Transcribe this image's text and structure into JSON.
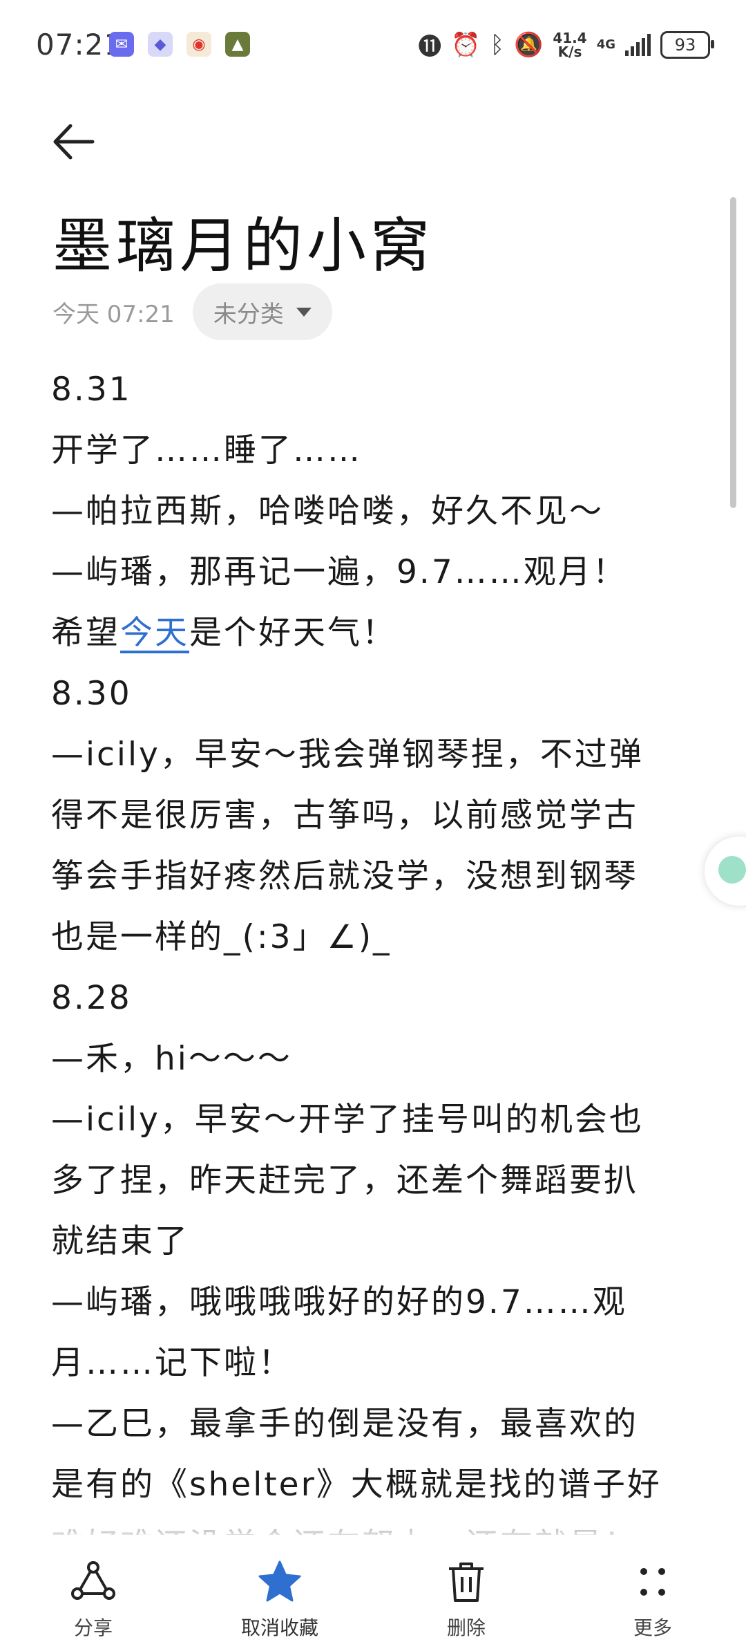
{
  "status_bar": {
    "time": "07:21",
    "network_speed": "41.4",
    "network_unit": "K/s",
    "network_type": "4G",
    "battery": "93",
    "app_icons": [
      "mail-app-icon",
      "shield-app-icon",
      "weibo-app-icon",
      "game-app-icon"
    ]
  },
  "note": {
    "title": "墨璃月的小窝",
    "date": "今天 07:21",
    "category": "未分类",
    "lines": [
      {
        "text": "8.31"
      },
      {
        "text": "开学了……睡了……"
      },
      {
        "text": "—帕拉西斯，哈喽哈喽，好久不见～"
      },
      {
        "text": "—屿璠，那再记一遍，9.7……观月！"
      },
      {
        "before": "希望",
        "link": "今天",
        "after": "是个好天气！"
      },
      {
        "text": "8.30"
      },
      {
        "text": "—icily，早安～我会弹钢琴捏，不过弹"
      },
      {
        "text": "得不是很厉害，古筝吗，以前感觉学古"
      },
      {
        "text": "筝会手指好疼然后就没学，没想到钢琴"
      },
      {
        "text": "也是一样的_(:3」∠)_"
      },
      {
        "text": "8.28"
      },
      {
        "text": "—禾，hi～～～"
      },
      {
        "text": "—icily，早安～开学了挂号叫的机会也"
      },
      {
        "text": "多了捏，昨天赶完了，还差个舞蹈要扒"
      },
      {
        "text": "就结束了"
      },
      {
        "text": "—屿璠，哦哦哦哦好的好的9.7……观"
      },
      {
        "text": "月……记下啦！"
      },
      {
        "text": "—乙巳，最拿手的倒是没有，最喜欢的"
      },
      {
        "text": "是有的《shelter》大概就是找的谱子好"
      },
      {
        "text": "难好难还没学会还在努力…还有就是！"
      }
    ]
  },
  "toolbar": {
    "share": "分享",
    "unfavorite": "取消收藏",
    "delete": "删除",
    "more": "更多"
  },
  "colors": {
    "accent": "#2f6fd0",
    "text": "#1a1a1a",
    "muted": "#9a9a9a"
  }
}
